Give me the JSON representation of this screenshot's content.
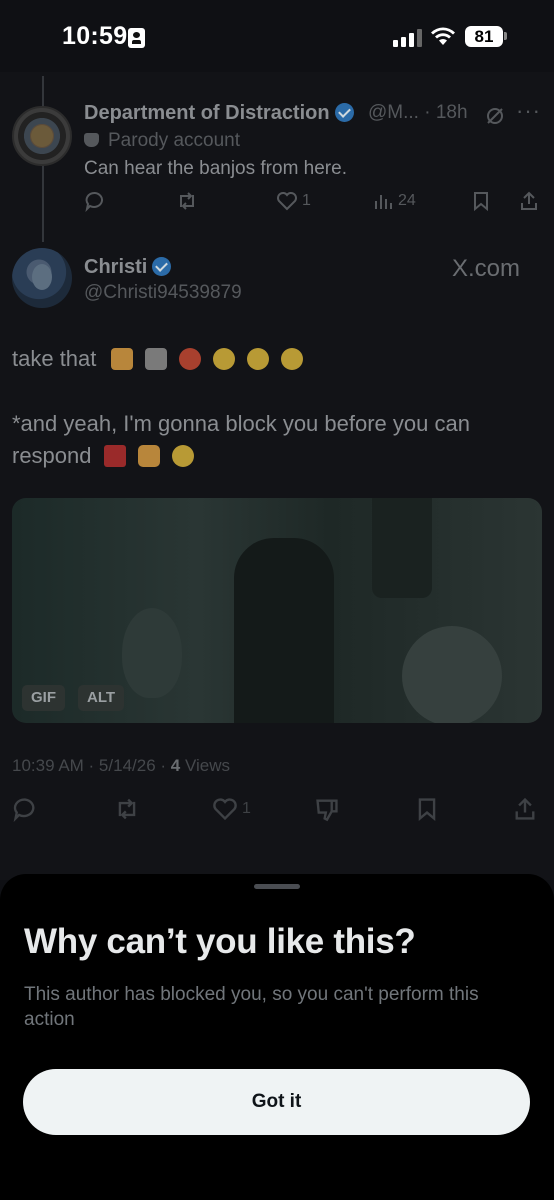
{
  "status_bar": {
    "time": "10:59",
    "battery": "81"
  },
  "parent_tweet": {
    "name": "Department of Distraction",
    "handle": "@M...",
    "age": "· 18h",
    "parody_label": "Parody account",
    "text": "Can hear the banjos from here.",
    "likes": "1",
    "views": "24"
  },
  "main_tweet": {
    "name": "Christi",
    "handle": "@Christi94539879",
    "watermark": "X.com",
    "line1": "take that",
    "line2": "*and yeah, I'm gonna block you before you can respond",
    "media_badges": [
      "GIF",
      "ALT"
    ],
    "timestamp": "10:39 AM · 5/14/26 ·",
    "views_count": "4",
    "views_label": "Views",
    "likes": "1"
  },
  "sheet": {
    "title": "Why can’t you like this?",
    "body": "This author has blocked you, so you can't perform this action",
    "button_label": "Got it"
  },
  "colors": {
    "accent_blue": "#2b6ba8",
    "background": "#0f1014",
    "sheet_bg": "#000000",
    "button_bg": "#eff3f4"
  },
  "icons": {
    "tweet_actions": [
      "reply-icon",
      "retweet-icon",
      "like-icon",
      "views-icon",
      "bookmark-icon",
      "share-icon"
    ],
    "main_actions": [
      "reply-icon",
      "retweet-icon",
      "like-icon",
      "dislike-icon",
      "bookmark-icon",
      "share-icon"
    ]
  }
}
